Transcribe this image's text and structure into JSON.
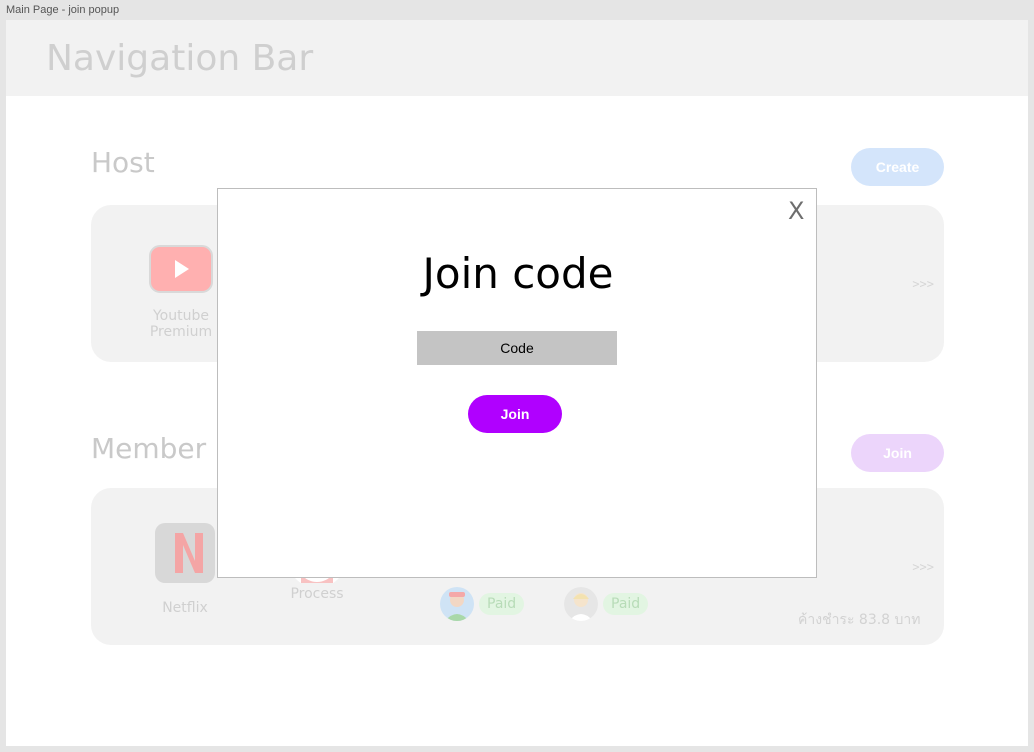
{
  "window": {
    "title": "Main Page - join popup"
  },
  "navbar": {
    "title": "Navigation Bar"
  },
  "host": {
    "title": "Host",
    "create_label": "Create",
    "apps": [
      {
        "name": "Youtube\nPremium",
        "icon": "youtube-icon"
      }
    ],
    "more": ">>>"
  },
  "member": {
    "title": "Member",
    "join_label": "Join",
    "apps": [
      {
        "name": "Netflix",
        "icon": "netflix-icon"
      },
      {
        "name": "Process",
        "icon": "process-icon"
      }
    ],
    "members": [
      {
        "status": "Paid"
      },
      {
        "status": "Paid"
      }
    ],
    "balance": "ค้างชำระ 83.8 บาท",
    "more": ">>>"
  },
  "popup": {
    "close": "X",
    "title": "Join code",
    "code_placeholder": "Code",
    "join_label": "Join"
  },
  "colors": {
    "accent_purple": "#b000ff",
    "create_blue": "#d4e5fb",
    "join_faded": "#ecd5fb"
  }
}
